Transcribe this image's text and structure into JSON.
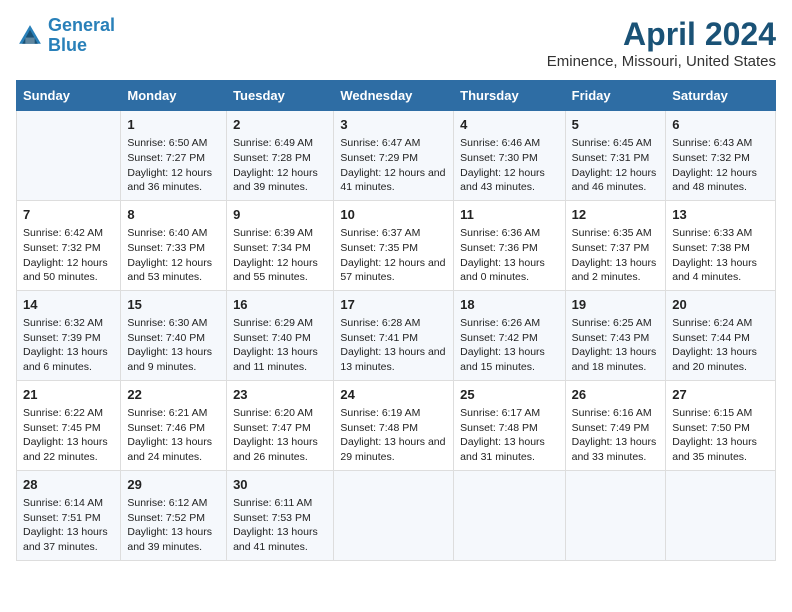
{
  "header": {
    "logo_line1": "General",
    "logo_line2": "Blue",
    "title": "April 2024",
    "subtitle": "Eminence, Missouri, United States"
  },
  "days_of_week": [
    "Sunday",
    "Monday",
    "Tuesday",
    "Wednesday",
    "Thursday",
    "Friday",
    "Saturday"
  ],
  "weeks": [
    [
      {
        "day": "",
        "sunrise": "",
        "sunset": "",
        "daylight": ""
      },
      {
        "day": "1",
        "sunrise": "Sunrise: 6:50 AM",
        "sunset": "Sunset: 7:27 PM",
        "daylight": "Daylight: 12 hours and 36 minutes."
      },
      {
        "day": "2",
        "sunrise": "Sunrise: 6:49 AM",
        "sunset": "Sunset: 7:28 PM",
        "daylight": "Daylight: 12 hours and 39 minutes."
      },
      {
        "day": "3",
        "sunrise": "Sunrise: 6:47 AM",
        "sunset": "Sunset: 7:29 PM",
        "daylight": "Daylight: 12 hours and 41 minutes."
      },
      {
        "day": "4",
        "sunrise": "Sunrise: 6:46 AM",
        "sunset": "Sunset: 7:30 PM",
        "daylight": "Daylight: 12 hours and 43 minutes."
      },
      {
        "day": "5",
        "sunrise": "Sunrise: 6:45 AM",
        "sunset": "Sunset: 7:31 PM",
        "daylight": "Daylight: 12 hours and 46 minutes."
      },
      {
        "day": "6",
        "sunrise": "Sunrise: 6:43 AM",
        "sunset": "Sunset: 7:32 PM",
        "daylight": "Daylight: 12 hours and 48 minutes."
      }
    ],
    [
      {
        "day": "7",
        "sunrise": "Sunrise: 6:42 AM",
        "sunset": "Sunset: 7:32 PM",
        "daylight": "Daylight: 12 hours and 50 minutes."
      },
      {
        "day": "8",
        "sunrise": "Sunrise: 6:40 AM",
        "sunset": "Sunset: 7:33 PM",
        "daylight": "Daylight: 12 hours and 53 minutes."
      },
      {
        "day": "9",
        "sunrise": "Sunrise: 6:39 AM",
        "sunset": "Sunset: 7:34 PM",
        "daylight": "Daylight: 12 hours and 55 minutes."
      },
      {
        "day": "10",
        "sunrise": "Sunrise: 6:37 AM",
        "sunset": "Sunset: 7:35 PM",
        "daylight": "Daylight: 12 hours and 57 minutes."
      },
      {
        "day": "11",
        "sunrise": "Sunrise: 6:36 AM",
        "sunset": "Sunset: 7:36 PM",
        "daylight": "Daylight: 13 hours and 0 minutes."
      },
      {
        "day": "12",
        "sunrise": "Sunrise: 6:35 AM",
        "sunset": "Sunset: 7:37 PM",
        "daylight": "Daylight: 13 hours and 2 minutes."
      },
      {
        "day": "13",
        "sunrise": "Sunrise: 6:33 AM",
        "sunset": "Sunset: 7:38 PM",
        "daylight": "Daylight: 13 hours and 4 minutes."
      }
    ],
    [
      {
        "day": "14",
        "sunrise": "Sunrise: 6:32 AM",
        "sunset": "Sunset: 7:39 PM",
        "daylight": "Daylight: 13 hours and 6 minutes."
      },
      {
        "day": "15",
        "sunrise": "Sunrise: 6:30 AM",
        "sunset": "Sunset: 7:40 PM",
        "daylight": "Daylight: 13 hours and 9 minutes."
      },
      {
        "day": "16",
        "sunrise": "Sunrise: 6:29 AM",
        "sunset": "Sunset: 7:40 PM",
        "daylight": "Daylight: 13 hours and 11 minutes."
      },
      {
        "day": "17",
        "sunrise": "Sunrise: 6:28 AM",
        "sunset": "Sunset: 7:41 PM",
        "daylight": "Daylight: 13 hours and 13 minutes."
      },
      {
        "day": "18",
        "sunrise": "Sunrise: 6:26 AM",
        "sunset": "Sunset: 7:42 PM",
        "daylight": "Daylight: 13 hours and 15 minutes."
      },
      {
        "day": "19",
        "sunrise": "Sunrise: 6:25 AM",
        "sunset": "Sunset: 7:43 PM",
        "daylight": "Daylight: 13 hours and 18 minutes."
      },
      {
        "day": "20",
        "sunrise": "Sunrise: 6:24 AM",
        "sunset": "Sunset: 7:44 PM",
        "daylight": "Daylight: 13 hours and 20 minutes."
      }
    ],
    [
      {
        "day": "21",
        "sunrise": "Sunrise: 6:22 AM",
        "sunset": "Sunset: 7:45 PM",
        "daylight": "Daylight: 13 hours and 22 minutes."
      },
      {
        "day": "22",
        "sunrise": "Sunrise: 6:21 AM",
        "sunset": "Sunset: 7:46 PM",
        "daylight": "Daylight: 13 hours and 24 minutes."
      },
      {
        "day": "23",
        "sunrise": "Sunrise: 6:20 AM",
        "sunset": "Sunset: 7:47 PM",
        "daylight": "Daylight: 13 hours and 26 minutes."
      },
      {
        "day": "24",
        "sunrise": "Sunrise: 6:19 AM",
        "sunset": "Sunset: 7:48 PM",
        "daylight": "Daylight: 13 hours and 29 minutes."
      },
      {
        "day": "25",
        "sunrise": "Sunrise: 6:17 AM",
        "sunset": "Sunset: 7:48 PM",
        "daylight": "Daylight: 13 hours and 31 minutes."
      },
      {
        "day": "26",
        "sunrise": "Sunrise: 6:16 AM",
        "sunset": "Sunset: 7:49 PM",
        "daylight": "Daylight: 13 hours and 33 minutes."
      },
      {
        "day": "27",
        "sunrise": "Sunrise: 6:15 AM",
        "sunset": "Sunset: 7:50 PM",
        "daylight": "Daylight: 13 hours and 35 minutes."
      }
    ],
    [
      {
        "day": "28",
        "sunrise": "Sunrise: 6:14 AM",
        "sunset": "Sunset: 7:51 PM",
        "daylight": "Daylight: 13 hours and 37 minutes."
      },
      {
        "day": "29",
        "sunrise": "Sunrise: 6:12 AM",
        "sunset": "Sunset: 7:52 PM",
        "daylight": "Daylight: 13 hours and 39 minutes."
      },
      {
        "day": "30",
        "sunrise": "Sunrise: 6:11 AM",
        "sunset": "Sunset: 7:53 PM",
        "daylight": "Daylight: 13 hours and 41 minutes."
      },
      {
        "day": "",
        "sunrise": "",
        "sunset": "",
        "daylight": ""
      },
      {
        "day": "",
        "sunrise": "",
        "sunset": "",
        "daylight": ""
      },
      {
        "day": "",
        "sunrise": "",
        "sunset": "",
        "daylight": ""
      },
      {
        "day": "",
        "sunrise": "",
        "sunset": "",
        "daylight": ""
      }
    ]
  ]
}
